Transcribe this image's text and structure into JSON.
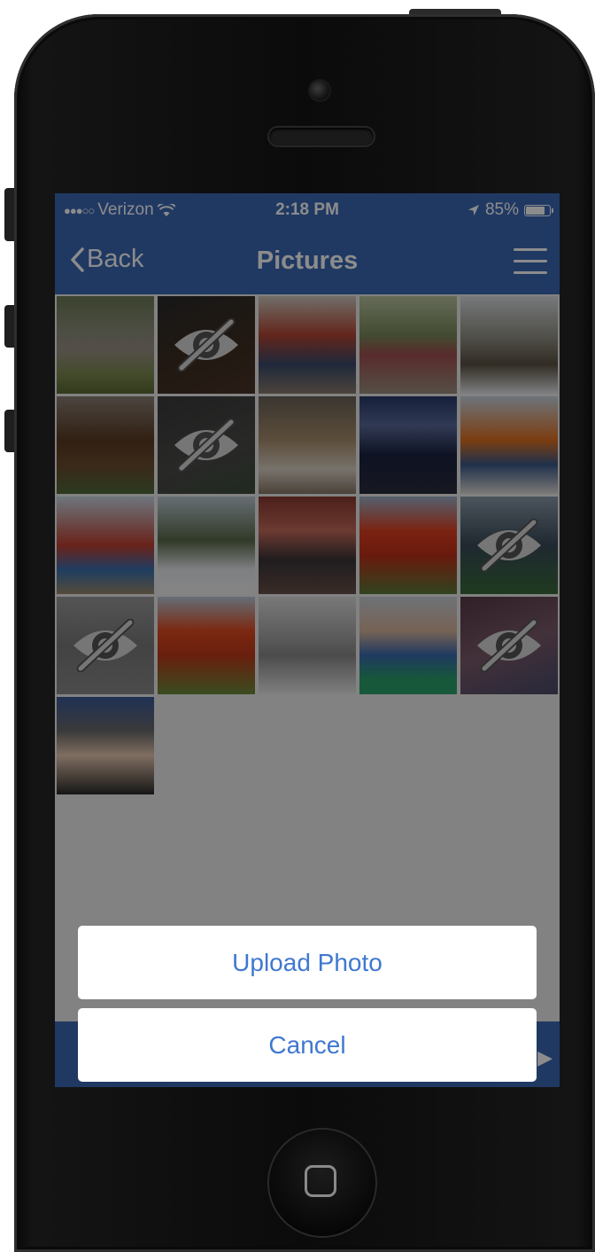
{
  "status_bar": {
    "signal": "●●●○○",
    "carrier": "Verizon",
    "time": "2:18 PM",
    "battery_percent": "85%",
    "battery_level": 0.85
  },
  "nav": {
    "back_label": "Back",
    "title": "Pictures"
  },
  "photos": [
    {
      "hidden": false
    },
    {
      "hidden": true
    },
    {
      "hidden": false
    },
    {
      "hidden": false
    },
    {
      "hidden": false
    },
    {
      "hidden": false
    },
    {
      "hidden": true
    },
    {
      "hidden": false
    },
    {
      "hidden": false
    },
    {
      "hidden": false
    },
    {
      "hidden": false
    },
    {
      "hidden": false
    },
    {
      "hidden": false
    },
    {
      "hidden": false
    },
    {
      "hidden": true
    },
    {
      "hidden": true
    },
    {
      "hidden": false
    },
    {
      "hidden": false
    },
    {
      "hidden": false
    },
    {
      "hidden": true
    },
    {
      "hidden": false
    }
  ],
  "action_sheet": {
    "upload_label": "Upload Photo",
    "cancel_label": "Cancel"
  },
  "colors": {
    "brand_blue": "#3b68b5",
    "action_text": "#3f78cf"
  }
}
